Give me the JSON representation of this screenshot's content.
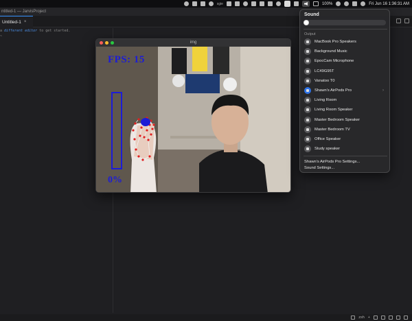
{
  "menubar": {
    "input_label": "sgie",
    "battery": "100%",
    "clock": "Fri Jun 16  1:36:31 AM"
  },
  "editor": {
    "window_title": "ntitled-1 — JarvisProject",
    "tab_label": "Untitled-1",
    "tab_close": "×",
    "hint_prefix": "a ",
    "hint_link": "different editor",
    "hint_suffix": " to get started.",
    "line2": "~",
    "status_items": [
      "zsh",
      "+"
    ]
  },
  "img_window": {
    "title": "img",
    "fps_text": "FPS: 15",
    "volume_percent_text": "0%",
    "volume_level": 0,
    "colors": {
      "overlay": "#1c1cd6",
      "landmark": "#e02020"
    }
  },
  "sound_menu": {
    "title": "Sound",
    "volume_level": 0,
    "section_label": "Output",
    "devices": [
      {
        "name": "MacBook Pro Speakers",
        "icon": "laptop-icon"
      },
      {
        "name": "Background Music",
        "icon": "speaker-icon"
      },
      {
        "name": "EpocCam Microphone",
        "icon": "speaker-icon"
      },
      {
        "name": "LC49G95T",
        "icon": "display-icon"
      },
      {
        "name": "Vanatoo T0",
        "icon": "speaker-icon"
      },
      {
        "name": "Shawn's AirPods Pro",
        "icon": "airpods-icon",
        "active": true,
        "chevron": "›"
      },
      {
        "name": "Living Room",
        "icon": "homepod-icon"
      },
      {
        "name": "Living Room Speaker",
        "icon": "homepod-icon"
      },
      {
        "name": "Master Bedroom Speaker",
        "icon": "homepod-icon"
      },
      {
        "name": "Master Bedroom TV",
        "icon": "tv-icon"
      },
      {
        "name": "Office Speaker",
        "icon": "homepod-icon"
      },
      {
        "name": "Study speaker",
        "icon": "homepod-icon"
      }
    ],
    "settings_links": [
      "Shawn's AirPods Pro Settings...",
      "Sound Settings..."
    ]
  }
}
